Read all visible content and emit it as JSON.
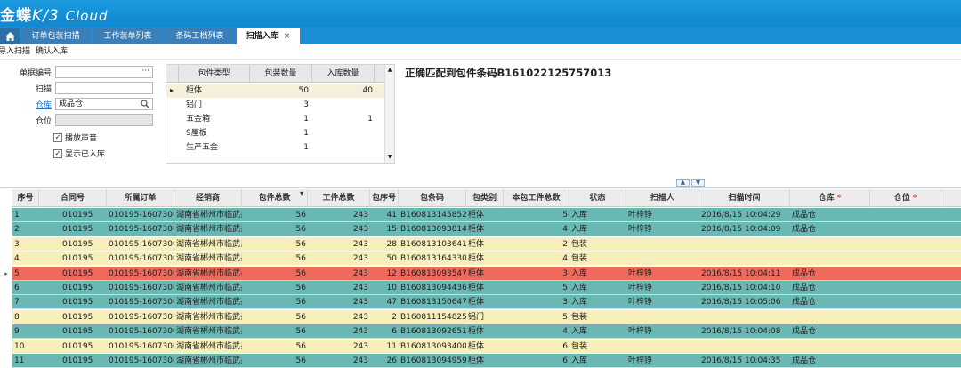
{
  "app": {
    "logo_main": "金蝶",
    "logo_sub": "K/3",
    "logo_cloud": "Cloud"
  },
  "tabs": [
    {
      "label": "订单包装扫描"
    },
    {
      "label": "工作装单列表"
    },
    {
      "label": "条码工档列表"
    },
    {
      "label": "扫描入库",
      "close": "×"
    }
  ],
  "toolbar": {
    "items": [
      "导入扫描",
      "确认入库"
    ]
  },
  "form": {
    "order_no_label": "单据编号",
    "order_no_btn": "···",
    "scan_label": "扫描",
    "warehouse_label": "仓库",
    "warehouse_value": "成品仓",
    "location_label": "仓位",
    "chk_sound": "播放声音",
    "chk_show_in": "显示已入库"
  },
  "small_grid": {
    "headers": [
      "包件类型",
      "包装数量",
      "入库数量"
    ],
    "rows": [
      {
        "type": "柜体",
        "qty": "50",
        "in_qty": "40"
      },
      {
        "type": "铝门",
        "qty": "3",
        "in_qty": ""
      },
      {
        "type": "五金箱",
        "qty": "1",
        "in_qty": "1"
      },
      {
        "type": "9厘板",
        "qty": "1",
        "in_qty": ""
      },
      {
        "type": "生产五金",
        "qty": "1",
        "in_qty": ""
      }
    ]
  },
  "message": "正确匹配到包件条码B161022125757013",
  "main_grid": {
    "headers": [
      "序号",
      "合同号",
      "所属订单",
      "经销商",
      "包件总数",
      "工件总数",
      "包序号",
      "包条码",
      "包类别",
      "本包工件总数",
      "状态",
      "扫描人",
      "扫描时间",
      "仓库",
      "仓位"
    ],
    "rows": [
      {
        "seq": "1",
        "contract": "010195",
        "order": "010195-16073000",
        "dealer": "湖南省郴州市临武县",
        "pkg_total": "56",
        "part_total": "243",
        "pkg_seq": "41",
        "barcode": "B1608131458523",
        "pkg_type": "柜体",
        "part_count": "5",
        "status": "入库",
        "scanner": "叶梓铮",
        "scan_time": "2016/8/15 10:04:29",
        "warehouse": "成品仓",
        "location": "",
        "style": "teal"
      },
      {
        "seq": "2",
        "contract": "010195",
        "order": "010195-16073000",
        "dealer": "湖南省郴州市临武县",
        "pkg_total": "56",
        "part_total": "243",
        "pkg_seq": "15",
        "barcode": "B1608130938146",
        "pkg_type": "柜体",
        "part_count": "4",
        "status": "入库",
        "scanner": "叶梓铮",
        "scan_time": "2016/8/15 10:04:09",
        "warehouse": "成品仓",
        "location": "",
        "style": "teal"
      },
      {
        "seq": "3",
        "contract": "010195",
        "order": "010195-16073000",
        "dealer": "湖南省郴州市临武县",
        "pkg_total": "56",
        "part_total": "243",
        "pkg_seq": "28",
        "barcode": "B1608131036410",
        "pkg_type": "柜体",
        "part_count": "2",
        "status": "包装",
        "scanner": "",
        "scan_time": "",
        "warehouse": "",
        "location": "",
        "style": "cream"
      },
      {
        "seq": "4",
        "contract": "010195",
        "order": "010195-16073000",
        "dealer": "湖南省郴州市临武县",
        "pkg_total": "56",
        "part_total": "243",
        "pkg_seq": "50",
        "barcode": "B1608131643307",
        "pkg_type": "柜体",
        "part_count": "4",
        "status": "包装",
        "scanner": "",
        "scan_time": "",
        "warehouse": "",
        "location": "",
        "style": "cream"
      },
      {
        "seq": "5",
        "contract": "010195",
        "order": "010195-16073000",
        "dealer": "湖南省郴州市临武县",
        "pkg_total": "56",
        "part_total": "243",
        "pkg_seq": "12",
        "barcode": "B1608130935472",
        "pkg_type": "柜体",
        "part_count": "3",
        "status": "入库",
        "scanner": "叶梓铮",
        "scan_time": "2016/8/15 10:04:11",
        "warehouse": "成品仓",
        "location": "",
        "style": "red"
      },
      {
        "seq": "6",
        "contract": "010195",
        "order": "010195-16073000",
        "dealer": "湖南省郴州市临武县",
        "pkg_total": "56",
        "part_total": "243",
        "pkg_seq": "10",
        "barcode": "B1608130944367",
        "pkg_type": "柜体",
        "part_count": "5",
        "status": "入库",
        "scanner": "叶梓铮",
        "scan_time": "2016/8/15 10:04:10",
        "warehouse": "成品仓",
        "location": "",
        "style": "teal"
      },
      {
        "seq": "7",
        "contract": "010195",
        "order": "010195-16073000",
        "dealer": "湖南省郴州市临武县",
        "pkg_total": "56",
        "part_total": "243",
        "pkg_seq": "47",
        "barcode": "B1608131506476",
        "pkg_type": "柜体",
        "part_count": "3",
        "status": "入库",
        "scanner": "叶梓铮",
        "scan_time": "2016/8/15 10:05:06",
        "warehouse": "成品仓",
        "location": "",
        "style": "teal"
      },
      {
        "seq": "8",
        "contract": "010195",
        "order": "010195-16073000",
        "dealer": "湖南省郴州市临武县",
        "pkg_total": "56",
        "part_total": "243",
        "pkg_seq": "2",
        "barcode": "B160811154825",
        "pkg_type": "铝门",
        "part_count": "5",
        "status": "包装",
        "scanner": "",
        "scan_time": "",
        "warehouse": "",
        "location": "",
        "style": "cream"
      },
      {
        "seq": "9",
        "contract": "010195",
        "order": "010195-16073000",
        "dealer": "湖南省郴州市临武县",
        "pkg_total": "56",
        "part_total": "243",
        "pkg_seq": "6",
        "barcode": "B1608130926517",
        "pkg_type": "柜体",
        "part_count": "4",
        "status": "入库",
        "scanner": "叶梓铮",
        "scan_time": "2016/8/15 10:04:08",
        "warehouse": "成品仓",
        "location": "",
        "style": "teal"
      },
      {
        "seq": "10",
        "contract": "010195",
        "order": "010195-16073000",
        "dealer": "湖南省郴州市临武县",
        "pkg_total": "56",
        "part_total": "243",
        "pkg_seq": "11",
        "barcode": "B1608130934000",
        "pkg_type": "柜体",
        "part_count": "6",
        "status": "包装",
        "scanner": "",
        "scan_time": "",
        "warehouse": "",
        "location": "",
        "style": "cream"
      },
      {
        "seq": "11",
        "contract": "010195",
        "order": "010195-16073000",
        "dealer": "湖南省郴州市临武县",
        "pkg_total": "56",
        "part_total": "243",
        "pkg_seq": "26",
        "barcode": "B1608130949594",
        "pkg_type": "柜体",
        "part_count": "6",
        "status": "入库",
        "scanner": "叶梓铮",
        "scan_time": "2016/8/15 10:04:35",
        "warehouse": "成品仓",
        "location": "",
        "style": "teal"
      }
    ]
  }
}
